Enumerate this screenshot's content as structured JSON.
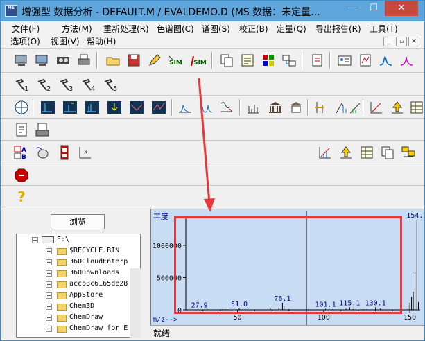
{
  "window": {
    "title": "增强型 数据分析 - DEFAULT.M / EVALDEMO.D    (MS 数据：未定量...",
    "icon_text": "MS",
    "minimize": "—",
    "maximize": "☐",
    "close": "✕"
  },
  "menus": [
    "文件(F)",
    "方法(M)",
    "重新处理(R)",
    "色谱图(C)",
    "谱图(S)",
    "校正(B)",
    "定量(Q)",
    "导出报告(R)",
    "工具(T)",
    "选项(O)",
    "视图(V)",
    "帮助(H)"
  ],
  "mdi_controls": [
    "_",
    "▫",
    "✕"
  ],
  "toolbar_row1": [
    "pc-icon",
    "pc2-icon",
    "tape-icon",
    "printer-icon",
    "open-folder-icon",
    "save-disk-icon",
    "edit-icon",
    "sim-icon",
    "asim-icon",
    "copy-icon",
    "report-icon",
    "grid-icon",
    "export-icon",
    "page-icon",
    "card-icon",
    "sheet-icon",
    "peak-icon"
  ],
  "tools_row2": [
    "1",
    "2",
    "3",
    "4",
    "5"
  ],
  "left_pane": {
    "browse_label": "浏览",
    "tree_root": "E:\\",
    "tree_items": [
      "$RECYCLE.BIN",
      "360CloudEnterp",
      "360Downloads",
      "accb3c6165de28",
      "AppStore",
      "Chem3D",
      "ChemDraw",
      "ChemDraw for E"
    ]
  },
  "chart_data": {
    "type": "bar",
    "title": "",
    "ylabel": "丰度",
    "xlabel": "m/z-->",
    "ylim": [
      0,
      1450000
    ],
    "yticks": [
      0,
      500000,
      1000000
    ],
    "ytick_labels": [
      "0",
      "500000",
      "1000000"
    ],
    "xlim": [
      20,
      156
    ],
    "xticks": [
      50,
      100,
      150
    ],
    "x": [
      27.9,
      29,
      39,
      41,
      43,
      51,
      53,
      55,
      57,
      63,
      65,
      69,
      74,
      76.1,
      77,
      80,
      91,
      101.1,
      105,
      113,
      115.1,
      117,
      123,
      125,
      130.1,
      133,
      145,
      149,
      150,
      151,
      152,
      153,
      154.1,
      155
    ],
    "values": [
      3000,
      2000,
      6000,
      10000,
      8000,
      22000,
      9000,
      7000,
      5000,
      6000,
      5000,
      30000,
      25000,
      110000,
      60000,
      12000,
      9000,
      15000,
      8000,
      20000,
      40000,
      12000,
      10000,
      9000,
      40000,
      22000,
      30000,
      70000,
      110000,
      200000,
      280000,
      580000,
      1400000,
      120000
    ],
    "peak_labels": [
      {
        "x": 27.9,
        "label": "27.9"
      },
      {
        "x": 51.0,
        "label": "51.0"
      },
      {
        "x": 76.1,
        "label": "76.1"
      },
      {
        "x": 101.1,
        "label": "101.1"
      },
      {
        "x": 115.1,
        "label": "115.1"
      },
      {
        "x": 130.1,
        "label": "130.1"
      },
      {
        "x": 154.1,
        "label": "154.1"
      }
    ],
    "cursor_x": 90,
    "colors": {
      "background": "#c8dcf3",
      "axis": "#000000",
      "label": "#000080"
    }
  },
  "status": {
    "text": "就绪"
  },
  "annotation": {
    "color": "#e8383a"
  }
}
